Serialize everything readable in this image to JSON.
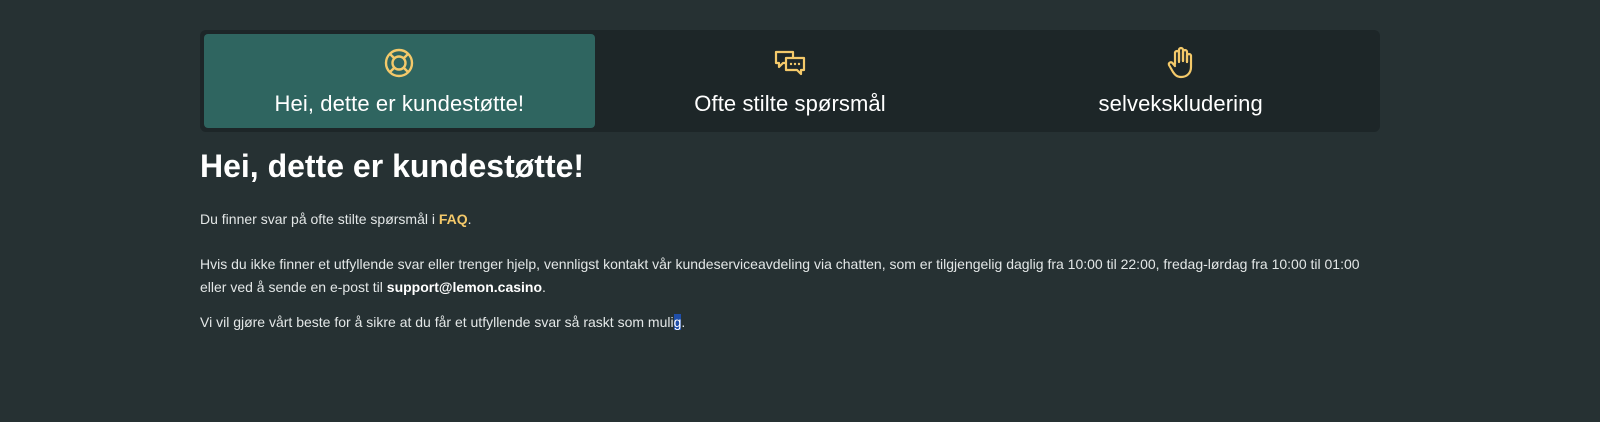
{
  "tabs": [
    {
      "label": "Hei, dette er kundestøtte!",
      "icon": "lifebuoy-icon",
      "active": true
    },
    {
      "label": "Ofte stilte spørsmål",
      "icon": "chat-bubbles-icon",
      "active": false
    },
    {
      "label": "selvekskludering",
      "icon": "hand-icon",
      "active": false
    }
  ],
  "colors": {
    "accent": "#f4c96a",
    "active_tab": "#2f6560",
    "tabbar": "#1d2628",
    "background": "#263133"
  },
  "main": {
    "heading": "Hei, dette er kundestøtte!",
    "para1_prefix": "Du finner svar på ofte stilte spørsmål i ",
    "faq_link": "FAQ",
    "para1_suffix": ".",
    "para2_prefix": "Hvis du ikke finner et utfyllende svar eller trenger hjelp, vennligst kontakt vår kundeserviceavdeling via chatten, som er tilgjengelig daglig fra 10:00 til 22:00, fredag-lørdag fra 10:00 til 01:00 eller ved å sende en e-post til ",
    "email": "support@lemon.casino",
    "para2_suffix": ".",
    "para3_prefix": "Vi vil gjøre vårt beste for å sikre at du får et utfyllende svar så raskt som muli",
    "para3_selected": "g",
    "para3_suffix": "."
  }
}
